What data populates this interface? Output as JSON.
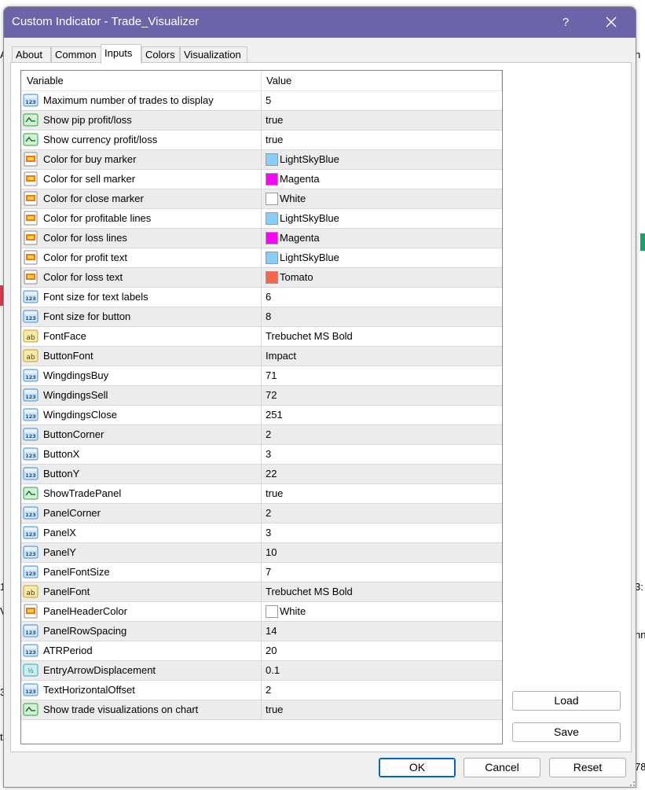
{
  "background": {
    "fragments": [
      "A",
      "h",
      "1",
      "3:",
      "V",
      "hn",
      "3",
      "t",
      "78"
    ]
  },
  "window": {
    "title": "Custom Indicator - Trade_Visualizer",
    "help_label": "?"
  },
  "tabs": [
    {
      "label": "About"
    },
    {
      "label": "Common"
    },
    {
      "label": "Inputs"
    },
    {
      "label": "Colors"
    },
    {
      "label": "Visualization"
    }
  ],
  "grid": {
    "headers": {
      "variable": "Variable",
      "value": "Value"
    },
    "rows": [
      {
        "icon": "int",
        "variable": "Maximum number of trades to display",
        "value": "5"
      },
      {
        "icon": "bool",
        "variable": "Show pip profit/loss",
        "value": "true"
      },
      {
        "icon": "bool",
        "variable": "Show currency profit/loss",
        "value": "true"
      },
      {
        "icon": "color",
        "variable": "Color for buy marker",
        "value": "LightSkyBlue",
        "swatch": "#87CEFA"
      },
      {
        "icon": "color",
        "variable": "Color for sell marker",
        "value": "Magenta",
        "swatch": "#FF00FF"
      },
      {
        "icon": "color",
        "variable": "Color for close marker",
        "value": "White",
        "swatch": "#FFFFFF"
      },
      {
        "icon": "color",
        "variable": "Color for profitable lines",
        "value": "LightSkyBlue",
        "swatch": "#87CEFA"
      },
      {
        "icon": "color",
        "variable": "Color for loss lines",
        "value": "Magenta",
        "swatch": "#FF00FF"
      },
      {
        "icon": "color",
        "variable": "Color for profit text",
        "value": "LightSkyBlue",
        "swatch": "#87CEFA"
      },
      {
        "icon": "color",
        "variable": "Color for loss text",
        "value": "Tomato",
        "swatch": "#FF6347"
      },
      {
        "icon": "int",
        "variable": "Font size for text labels",
        "value": "6"
      },
      {
        "icon": "int",
        "variable": "Font size for button",
        "value": "8"
      },
      {
        "icon": "string",
        "variable": "FontFace",
        "value": "Trebuchet MS Bold"
      },
      {
        "icon": "string",
        "variable": "ButtonFont",
        "value": "Impact"
      },
      {
        "icon": "int",
        "variable": "WingdingsBuy",
        "value": "71"
      },
      {
        "icon": "int",
        "variable": "WingdingsSell",
        "value": "72"
      },
      {
        "icon": "int",
        "variable": "WingdingsClose",
        "value": "251"
      },
      {
        "icon": "int",
        "variable": "ButtonCorner",
        "value": "2"
      },
      {
        "icon": "int",
        "variable": "ButtonX",
        "value": "3"
      },
      {
        "icon": "int",
        "variable": "ButtonY",
        "value": "22"
      },
      {
        "icon": "bool",
        "variable": "ShowTradePanel",
        "value": "true"
      },
      {
        "icon": "int",
        "variable": "PanelCorner",
        "value": "2"
      },
      {
        "icon": "int",
        "variable": "PanelX",
        "value": "3"
      },
      {
        "icon": "int",
        "variable": "PanelY",
        "value": "10"
      },
      {
        "icon": "int",
        "variable": "PanelFontSize",
        "value": "7"
      },
      {
        "icon": "string",
        "variable": "PanelFont",
        "value": "Trebuchet MS Bold"
      },
      {
        "icon": "color",
        "variable": "PanelHeaderColor",
        "value": "White",
        "swatch": "#FFFFFF"
      },
      {
        "icon": "int",
        "variable": "PanelRowSpacing",
        "value": "14"
      },
      {
        "icon": "int",
        "variable": "ATRPeriod",
        "value": "20"
      },
      {
        "icon": "double",
        "variable": "EntryArrowDisplacement",
        "value": "0.1"
      },
      {
        "icon": "int",
        "variable": "TextHorizontalOffset",
        "value": "2"
      },
      {
        "icon": "bool",
        "variable": "Show trade visualizations on chart",
        "value": "true"
      }
    ]
  },
  "side_buttons": {
    "load": "Load",
    "save": "Save"
  },
  "footer_buttons": {
    "ok": "OK",
    "cancel": "Cancel",
    "reset": "Reset"
  },
  "colors": {
    "titlebar": "#6b64a8",
    "int_icon": "#4a90d9",
    "bool_icon": "#2e9e4a",
    "color_icon": "#f07818",
    "string_icon": "#c8a02a",
    "double_icon": "#3aaabb"
  }
}
